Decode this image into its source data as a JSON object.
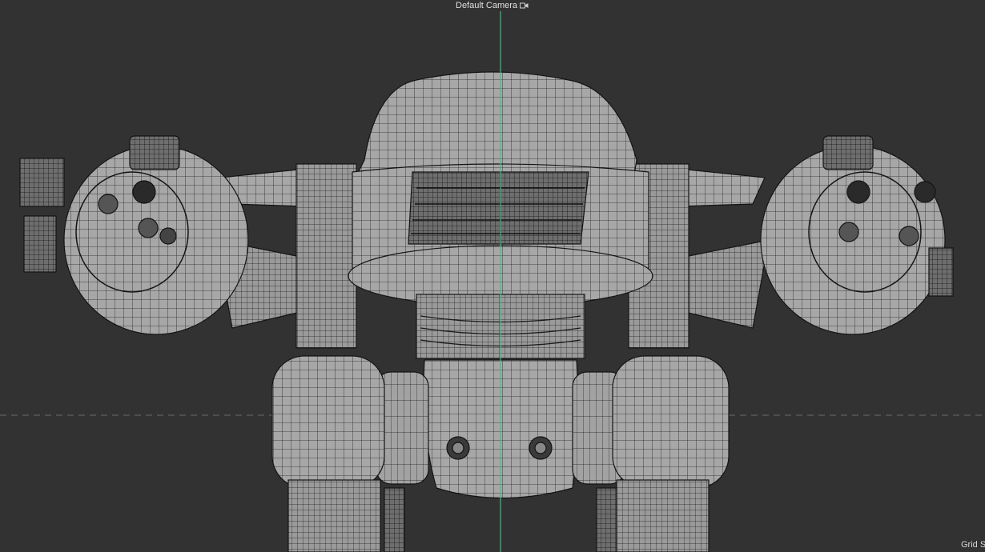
{
  "viewport": {
    "camera_label": "Default Camera",
    "camera_icon": "camera-icon",
    "grid_label": "Grid S",
    "colors": {
      "background": "#323232",
      "axis_vertical": "#3fbf7f",
      "horizon_dashed": "#6a6a6a",
      "mesh_fill": "#a9a9a9",
      "mesh_wire": "#1a1a1a"
    }
  }
}
